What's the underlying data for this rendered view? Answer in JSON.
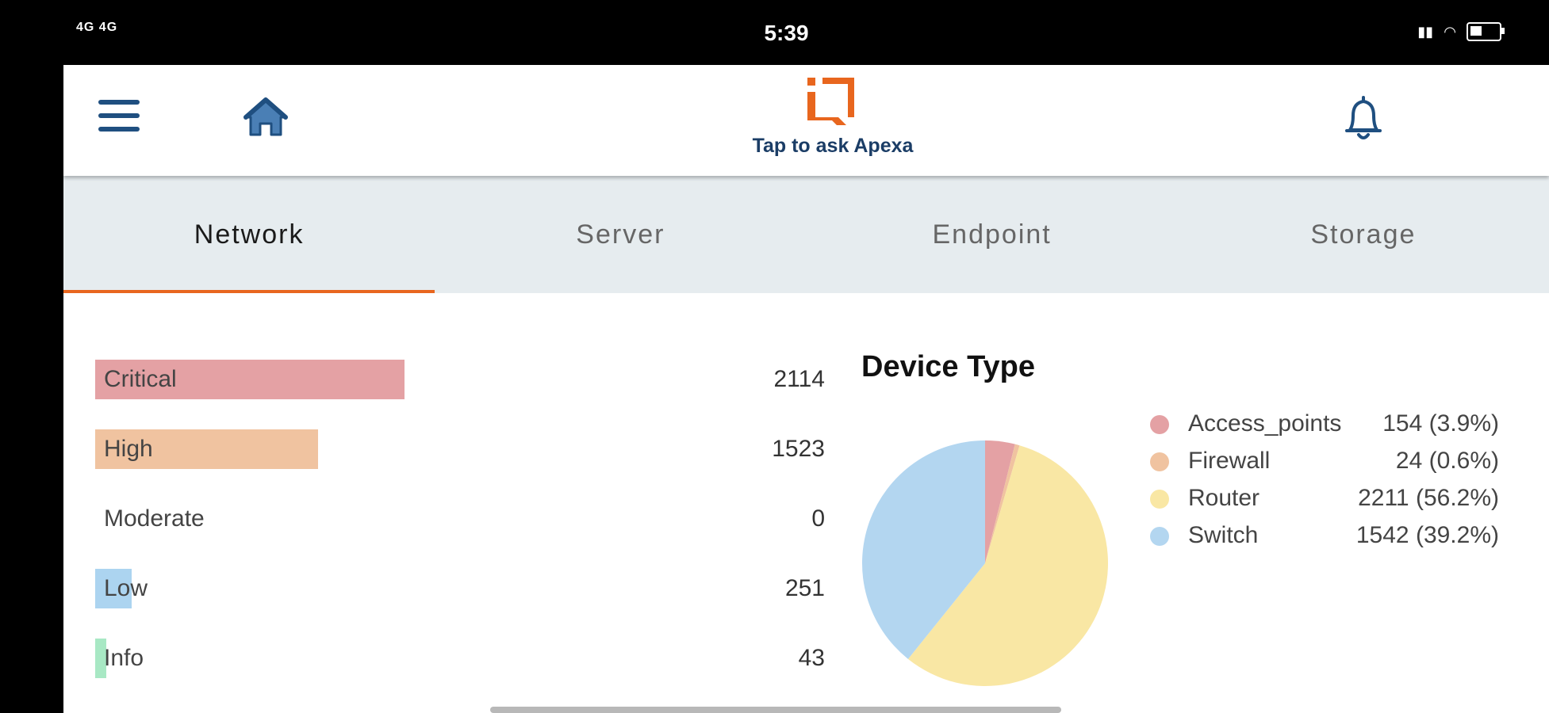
{
  "status_bar": {
    "network_left": "4G 4G",
    "time": "5:39",
    "battery_level": 0.4
  },
  "header": {
    "assistant_caption": "Tap to ask Apexa",
    "icons": [
      "menu-icon",
      "home-icon",
      "apexa-logo-icon",
      "bell-icon"
    ],
    "accent_color": "#e8661e",
    "icon_color": "#1f4f80"
  },
  "tabs": [
    {
      "label": "Network",
      "active": true
    },
    {
      "label": "Server",
      "active": false
    },
    {
      "label": "Endpoint",
      "active": false
    },
    {
      "label": "Storage",
      "active": false
    }
  ],
  "severity": [
    {
      "label": "Critical",
      "count": "2114",
      "color": "#e4a1a4"
    },
    {
      "label": "High",
      "count": "1523",
      "color": "#f0c3a0"
    },
    {
      "label": "Moderate",
      "count": "0",
      "color": "#f4e6a0"
    },
    {
      "label": "Low",
      "count": "251",
      "color": "#acd4f0"
    },
    {
      "label": "Info",
      "count": "43",
      "color": "#a8e8c4"
    }
  ],
  "device_type": {
    "title": "Device Type",
    "legend": [
      {
        "name": "Access_points",
        "value": "154 (3.9%)",
        "color": "#e4a1a4"
      },
      {
        "name": "Firewall",
        "value": "24 (0.6%)",
        "color": "#f0c3a0"
      },
      {
        "name": "Router",
        "value": "2211 (56.2%)",
        "color": "#f9e7a4"
      },
      {
        "name": "Switch",
        "value": "1542 (39.2%)",
        "color": "#b3d6f0"
      }
    ]
  },
  "chart_data": {
    "type": "pie",
    "title": "Device Type",
    "categories": [
      "Access_points",
      "Firewall",
      "Router",
      "Switch"
    ],
    "values": [
      154,
      24,
      2211,
      1542
    ],
    "percent": [
      3.9,
      0.6,
      56.2,
      39.2
    ],
    "colors": [
      "#e4a1a4",
      "#f0c3a0",
      "#f9e7a4",
      "#b3d6f0"
    ],
    "legend_position": "right"
  },
  "severity_chart": {
    "type": "bar",
    "categories": [
      "Critical",
      "High",
      "Moderate",
      "Low",
      "Info"
    ],
    "values": [
      2114,
      1523,
      0,
      251,
      43
    ]
  }
}
